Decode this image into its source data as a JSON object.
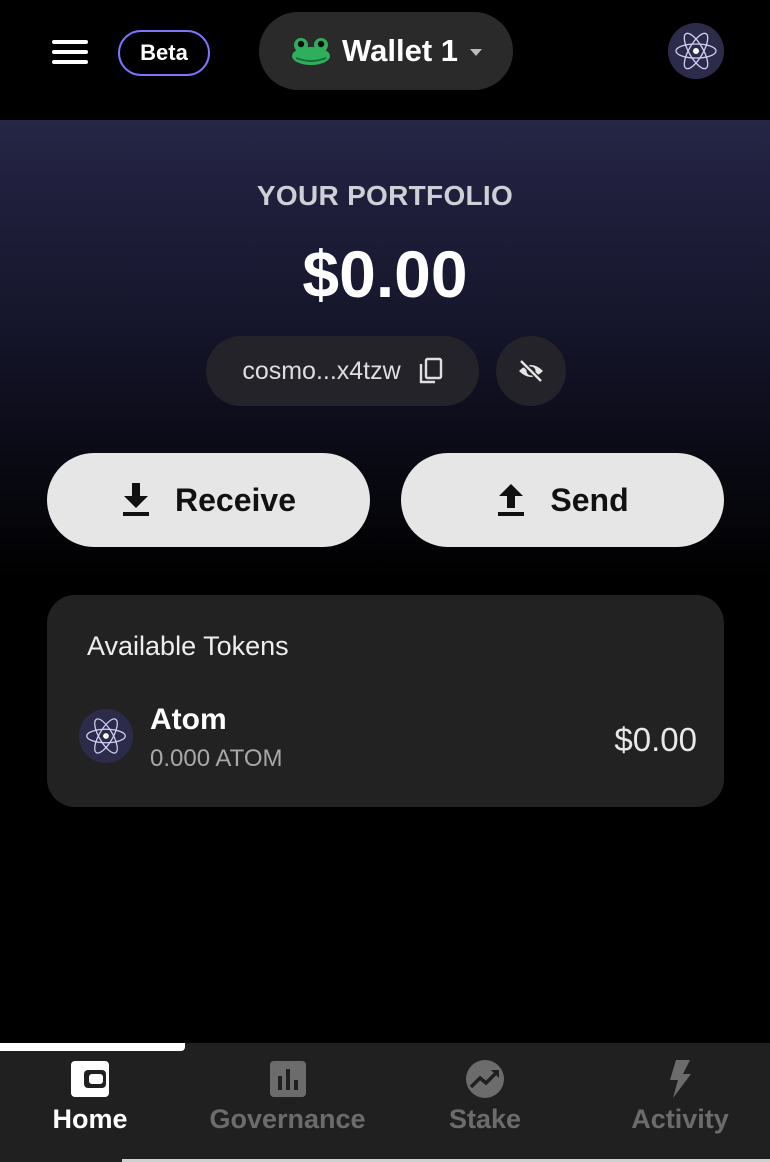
{
  "header": {
    "beta_label": "Beta",
    "wallet_name": "Wallet 1",
    "icons": [
      "menu-icon",
      "frog-icon",
      "chevron-down-icon",
      "cosmos-avatar-icon"
    ]
  },
  "portfolio": {
    "label": "YOUR PORTFOLIO",
    "value": "$0.00",
    "address": "cosmo...x4tzw"
  },
  "actions": {
    "receive_label": "Receive",
    "send_label": "Send"
  },
  "tokens": {
    "title": "Available Tokens",
    "items": [
      {
        "name": "Atom",
        "balance": "0.000 ATOM",
        "value": "$0.00",
        "icon": "cosmos-icon"
      }
    ]
  },
  "nav": {
    "items": [
      {
        "label": "Home",
        "icon": "wallet-icon",
        "active": true
      },
      {
        "label": "Governance",
        "icon": "bar-chart-icon",
        "active": false
      },
      {
        "label": "Stake",
        "icon": "trend-up-icon",
        "active": false
      },
      {
        "label": "Activity",
        "icon": "bolt-icon",
        "active": false
      }
    ]
  },
  "colors": {
    "accent_border": "#7b75ff",
    "card_bg": "#222222",
    "button_bg": "#e6e6e6",
    "nav_bg": "#202020"
  }
}
